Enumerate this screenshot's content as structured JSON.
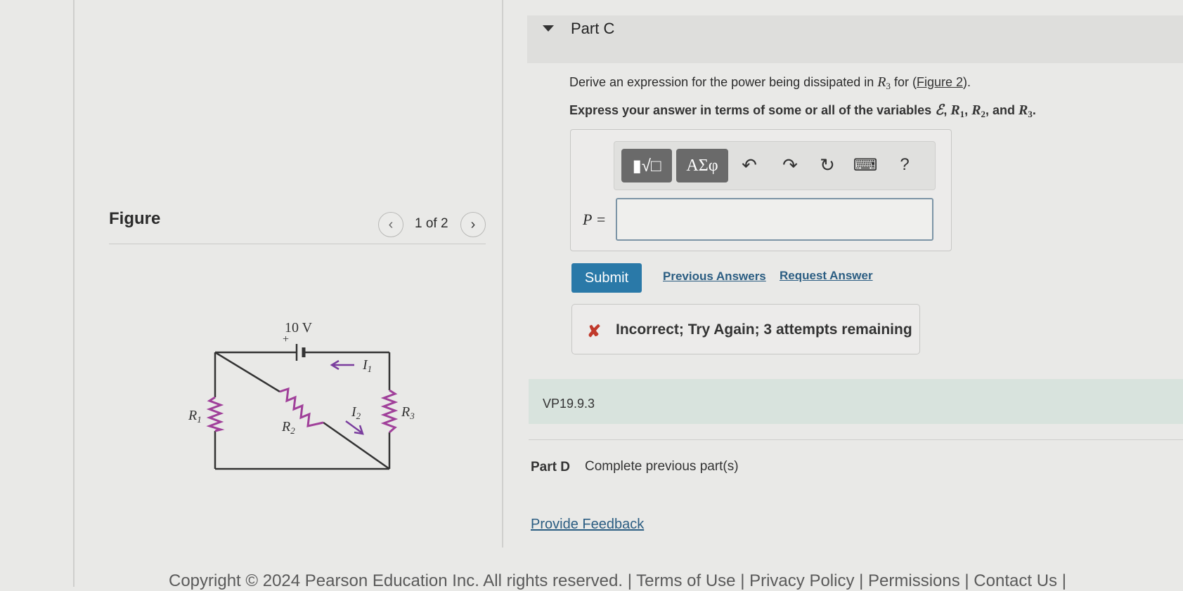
{
  "partC": {
    "title": "Part C",
    "question": {
      "prefix": "Derive an expression for the power being dissipated in ",
      "var": "R",
      "var_sub": "3",
      "mid": " for (",
      "link": "Figure 2",
      "end": ")."
    },
    "instruction": {
      "prefix": "Express your answer in terms of some or all of the variables ",
      "var1": "ℰ",
      "var2": "R",
      "var2_sub": "1",
      "var3": "R",
      "var3_sub": "2",
      "and": ", and ",
      "var4": "R",
      "var4_sub": "3",
      "sep": ", ",
      "end": "."
    },
    "toolbar": {
      "templates_label": "▮√□",
      "symbols_label": "ΑΣφ",
      "undo_icon": "↶",
      "redo_icon": "↷",
      "reset_icon": "↻",
      "keyboard_icon": "⌨",
      "help_label": "?"
    },
    "answer_label": "P =",
    "answer_value": "",
    "submit_label": "Submit",
    "previous_answers_label": "Previous Answers",
    "request_answer_label": "Request Answer",
    "feedback_icon": "✘",
    "feedback_text": "Incorrect; Try Again; 3 attempts remaining"
  },
  "vp_label": "VP19.9.3",
  "partD": {
    "label": "Part D",
    "text": "Complete previous part(s)"
  },
  "provide_feedback": "Provide Feedback",
  "figure": {
    "title": "Figure",
    "counter": "1 of 2",
    "prev_icon": "‹",
    "next_icon": "›",
    "circuit": {
      "voltage": "10 V",
      "plus": "+",
      "r1": "R",
      "r1_sub": "1",
      "r2": "R",
      "r2_sub": "2",
      "r3": "R",
      "r3_sub": "3",
      "i1": "I",
      "i1_sub": "1",
      "i2": "I",
      "i2_sub": "2"
    }
  },
  "footer": "Copyright © 2024 Pearson Education Inc. All rights reserved.  |  Terms of Use  |  Privacy Policy  |  Permissions  |  Contact Us  |",
  "colors": {
    "resistor": "#a0409a",
    "wire": "#333333",
    "arrow": "#7a3d9e",
    "submit": "#2a79a8",
    "link": "#2b5d82",
    "error": "#c0392b"
  }
}
